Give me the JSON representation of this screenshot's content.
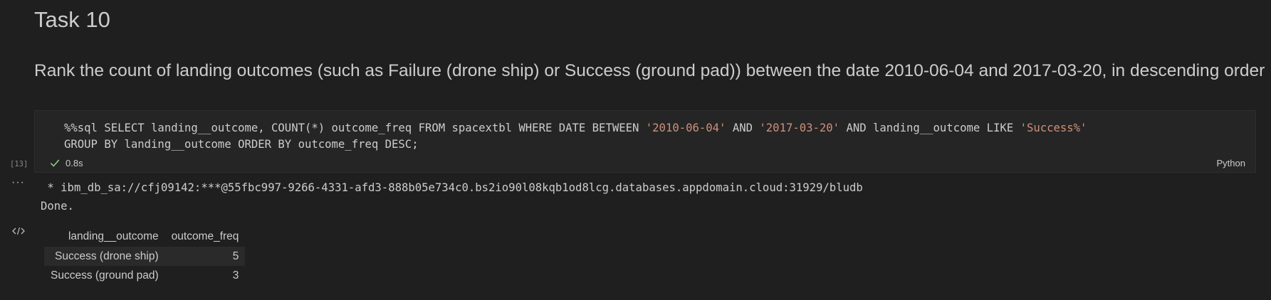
{
  "markdown": {
    "title": "Task 10",
    "description": "Rank the count of landing outcomes (such as Failure (drone ship) or Success (ground pad)) between the date 2010-06-04 and 2017-03-20, in descending order"
  },
  "cell": {
    "code_line1_a": "%%sql SELECT landing__outcome, COUNT(*) outcome_freq FROM spacextbl WHERE DATE BETWEEN ",
    "code_line1_str1": "'2010-06-04'",
    "code_line1_b": " AND ",
    "code_line1_str2": "'2017-03-20'",
    "code_line1_c": " AND landing__outcome LIKE ",
    "code_line1_str3": "'Success%'",
    "code_line2": "GROUP BY landing__outcome ORDER BY outcome_freq DESC;",
    "execution_count": "[13]",
    "duration": "0.8s",
    "language": "Python",
    "status_icon": "check-icon"
  },
  "output": {
    "connection": " * ibm_db_sa://cfj09142:***@55fbc997-9266-4331-afd3-888b05e734c0.bs2io90l08kqb1od8lcg.databases.appdomain.cloud:31929/bludb",
    "done": "Done.",
    "more_icon": "ellipsis-icon",
    "table": {
      "headers": [
        "landing__outcome",
        "outcome_freq"
      ],
      "rows": [
        [
          "Success (drone ship)",
          "5"
        ],
        [
          "Success (ground pad)",
          "3"
        ]
      ]
    }
  },
  "colors": {
    "background": "#1f1f1f",
    "cell_background": "#252526",
    "string": "#ce9178",
    "success_check": "#89d185"
  }
}
